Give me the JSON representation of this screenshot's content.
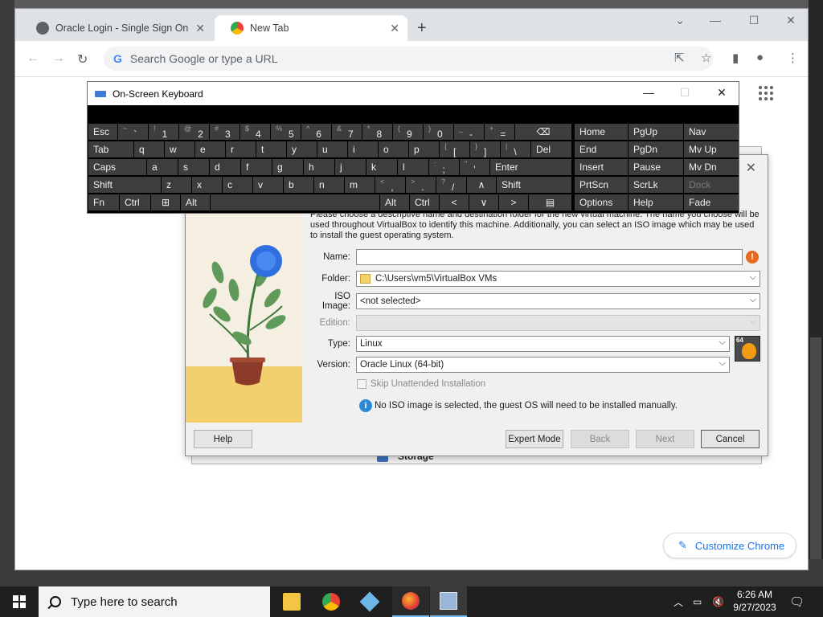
{
  "chrome": {
    "tabs": [
      {
        "label": "Oracle Login - Single Sign On",
        "active": false
      },
      {
        "label": "New Tab",
        "active": true
      }
    ],
    "omnibox_placeholder": "Search Google or type a URL",
    "customize_label": "Customize Chrome"
  },
  "osk": {
    "title": "On-Screen Keyboard",
    "row1": [
      {
        "shift": "~",
        "main": "`"
      },
      {
        "shift": "!",
        "main": "1"
      },
      {
        "shift": "@",
        "main": "2"
      },
      {
        "shift": "#",
        "main": "3"
      },
      {
        "shift": "$",
        "main": "4"
      },
      {
        "shift": "%",
        "main": "5"
      },
      {
        "shift": "^",
        "main": "6"
      },
      {
        "shift": "&",
        "main": "7"
      },
      {
        "shift": "*",
        "main": "8"
      },
      {
        "shift": "(",
        "main": "9"
      },
      {
        "shift": ")",
        "main": "0"
      },
      {
        "shift": "_",
        "main": "-"
      },
      {
        "shift": "+",
        "main": "="
      }
    ],
    "row2_letters": [
      "q",
      "w",
      "e",
      "r",
      "t",
      "y",
      "u",
      "i",
      "o",
      "p"
    ],
    "row2_brackets": [
      {
        "shift": "{",
        "main": "["
      },
      {
        "shift": "}",
        "main": "]"
      },
      {
        "shift": "|",
        "main": "\\"
      }
    ],
    "row3_letters": [
      "a",
      "s",
      "d",
      "f",
      "g",
      "h",
      "j",
      "k",
      "l"
    ],
    "row3_punct": [
      {
        "shift": ":",
        "main": ";"
      },
      {
        "shift": "\"",
        "main": "'"
      }
    ],
    "row4_letters": [
      "z",
      "x",
      "c",
      "v",
      "b",
      "n",
      "m"
    ],
    "row4_punct": [
      {
        "shift": "<",
        "main": ","
      },
      {
        "shift": ">",
        "main": "."
      },
      {
        "shift": "?",
        "main": "/"
      }
    ],
    "keys": {
      "esc": "Esc",
      "tab": "Tab",
      "caps": "Caps",
      "shift": "Shift",
      "fn": "Fn",
      "ctrl": "Ctrl",
      "alt": "Alt",
      "del": "Del",
      "enter": "Enter"
    },
    "nav_keys": [
      [
        "Home",
        "PgUp",
        "Nav"
      ],
      [
        "End",
        "PgDn",
        "Mv Up"
      ],
      [
        "Insert",
        "Pause",
        "Mv Dn"
      ],
      [
        "PrtScn",
        "ScrLk",
        "Dock"
      ],
      [
        "Options",
        "Help",
        "Fade"
      ]
    ]
  },
  "dialog": {
    "description": "Please choose a descriptive name and destination folder for the new virtual machine. The name you choose will be used throughout VirtualBox to identify this machine. Additionally, you can select an ISO image which may be used to install the guest operating system.",
    "fields": {
      "name_label": "Name:",
      "name_value": "",
      "folder_label": "Folder:",
      "folder_value": "C:\\Users\\vm5\\VirtualBox VMs",
      "iso_label": "ISO Image:",
      "iso_value": "<not selected>",
      "edition_label": "Edition:",
      "edition_value": "",
      "type_label": "Type:",
      "type_value": "Linux",
      "version_label": "Version:",
      "version_value": "Oracle Linux (64-bit)"
    },
    "os_badge": "64",
    "skip_unattended": "Skip Unattended Installation",
    "info_text": "No ISO image is selected, the guest OS will need to be installed manually.",
    "buttons": {
      "help": "Help",
      "expert": "Expert Mode",
      "back": "Back",
      "next": "Next",
      "cancel": "Cancel"
    }
  },
  "behind_window": {
    "storage_label": "Storage"
  },
  "taskbar": {
    "search_placeholder": "Type here to search",
    "time": "6:26 AM",
    "date": "9/27/2023"
  },
  "colors": {
    "accent": "#1a73e8",
    "osk_key": "#3d3d3d",
    "warn": "#e86a1e",
    "info": "#2a8ad8"
  }
}
